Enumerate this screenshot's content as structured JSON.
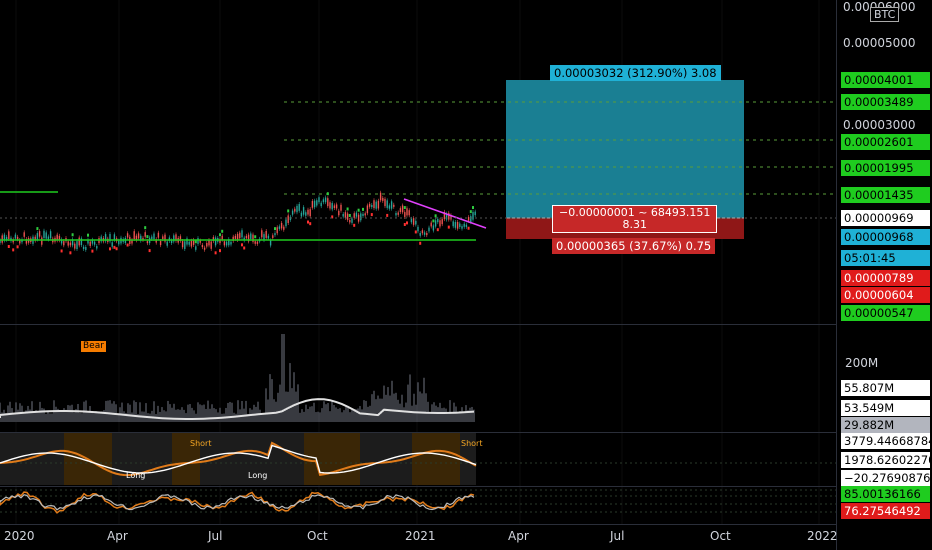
{
  "symbol_badge": "BTC",
  "price_axis": {
    "top_label": "0.00006000",
    "label_5": "0.00005000",
    "label_3": "0.00003000",
    "labels": [
      {
        "text": "0.00004001",
        "style": "g"
      },
      {
        "text": "0.00003489",
        "style": "g"
      },
      {
        "text": "0.00002601",
        "style": "g"
      },
      {
        "text": "0.00001995",
        "style": "g"
      },
      {
        "text": "0.00001435",
        "style": "g"
      },
      {
        "text": "0.00000969",
        "style": "w"
      },
      {
        "text": "0.00000968",
        "style": "c"
      },
      {
        "text": "05:01:45",
        "style": "c"
      },
      {
        "text": "0.00000789",
        "style": "r"
      },
      {
        "text": "0.00000604",
        "style": "r"
      },
      {
        "text": "0.00000547",
        "style": "g"
      }
    ]
  },
  "position_tool": {
    "target_label": "0.00003032 (312.90%) 3.08",
    "mid_label_1": "−0.00000001 ~ 68493.151",
    "mid_label_2": "8.31",
    "stop_label": "0.00000365 (37.67%) 0.75"
  },
  "volume_pane": {
    "badge": "Bear",
    "scale_label": "200M",
    "labels": [
      {
        "text": "55.807M",
        "style": "w"
      },
      {
        "text": "53.549M",
        "style": "w"
      },
      {
        "text": "29.882M",
        "style": "gr"
      }
    ]
  },
  "oscillator_pane": {
    "short_1": "Short",
    "short_2": "Short",
    "long_1": "Long",
    "long_2": "Long",
    "labels": [
      {
        "text": "3779.44668784",
        "style": "w"
      },
      {
        "text": "1978.62602270",
        "style": "w"
      },
      {
        "text": "−20.27690876",
        "style": "w"
      }
    ]
  },
  "rsi_pane": {
    "labels": [
      {
        "text": "85.00136166",
        "style": "g"
      },
      {
        "text": "76.27546492",
        "style": "r"
      }
    ]
  },
  "time_axis": [
    "2020",
    "Apr",
    "Jul",
    "Oct",
    "2021",
    "Apr",
    "Jul",
    "Oct",
    "2022"
  ],
  "colors": {
    "bg": "#000000",
    "up": "#26a69a",
    "down": "#ef5350",
    "target": "#1f8ea3",
    "stop": "#9b1c1c",
    "green_line": "#1fcc1f",
    "magenta": "#e040fb",
    "orange": "#e07b1a"
  }
}
